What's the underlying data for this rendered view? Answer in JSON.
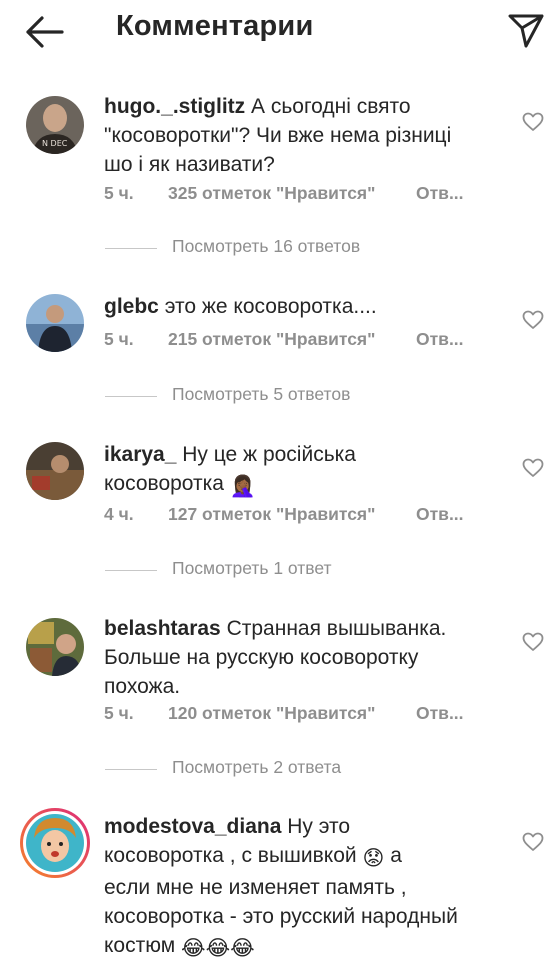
{
  "header": {
    "title": "Комментарии"
  },
  "colors": {
    "text": "#262626",
    "secondary": "#8e8e8e",
    "divider": "#c7c7c7",
    "story_ring_start": "#f58529",
    "story_ring_end": "#dd2a7b"
  },
  "icons": {
    "back": "arrow-left-icon",
    "send": "paper-plane-icon",
    "like": "heart-outline-icon"
  },
  "comments": [
    {
      "user": "hugo._.stiglitz",
      "lines": [
        "А сьогодні свято",
        "\"косоворотки\"? Чи вже нема різниці",
        "шо і як називати?"
      ],
      "time": "5 ч.",
      "likes": "325 отметок \"Нравится\"",
      "reply": "Отв...",
      "replies": "Посмотреть 16 ответов"
    },
    {
      "user": "glebc",
      "lines": [
        "это же косоворотка...."
      ],
      "time": "5 ч.",
      "likes": "215 отметок \"Нравится\"",
      "reply": "Отв...",
      "replies": "Посмотреть 5 ответов"
    },
    {
      "user": "ikarya_",
      "lines": [
        "Ну це ж російська",
        "косоворотка"
      ],
      "emoji": "🤦🏾‍♀️",
      "time": "4 ч.",
      "likes": "127 отметок \"Нравится\"",
      "reply": "Отв...",
      "replies": "Посмотреть 1 ответ"
    },
    {
      "user": "belashtaras",
      "lines": [
        "Странная вышыванка.",
        "Больше на русскую косоворотку",
        "похожа."
      ],
      "time": "5 ч.",
      "likes": "120 отметок \"Нравится\"",
      "reply": "Отв...",
      "replies": "Посмотреть 2 ответа"
    },
    {
      "user": "modestova_diana",
      "lines": [
        "Ну это",
        "косоворотка , с вышивкой",
        "а",
        "если мне не изменяет память ,",
        "косоворотка - это русский народный",
        "костюм"
      ],
      "emoji_mid": "😟",
      "emoji_end": "😂😂😂"
    }
  ]
}
